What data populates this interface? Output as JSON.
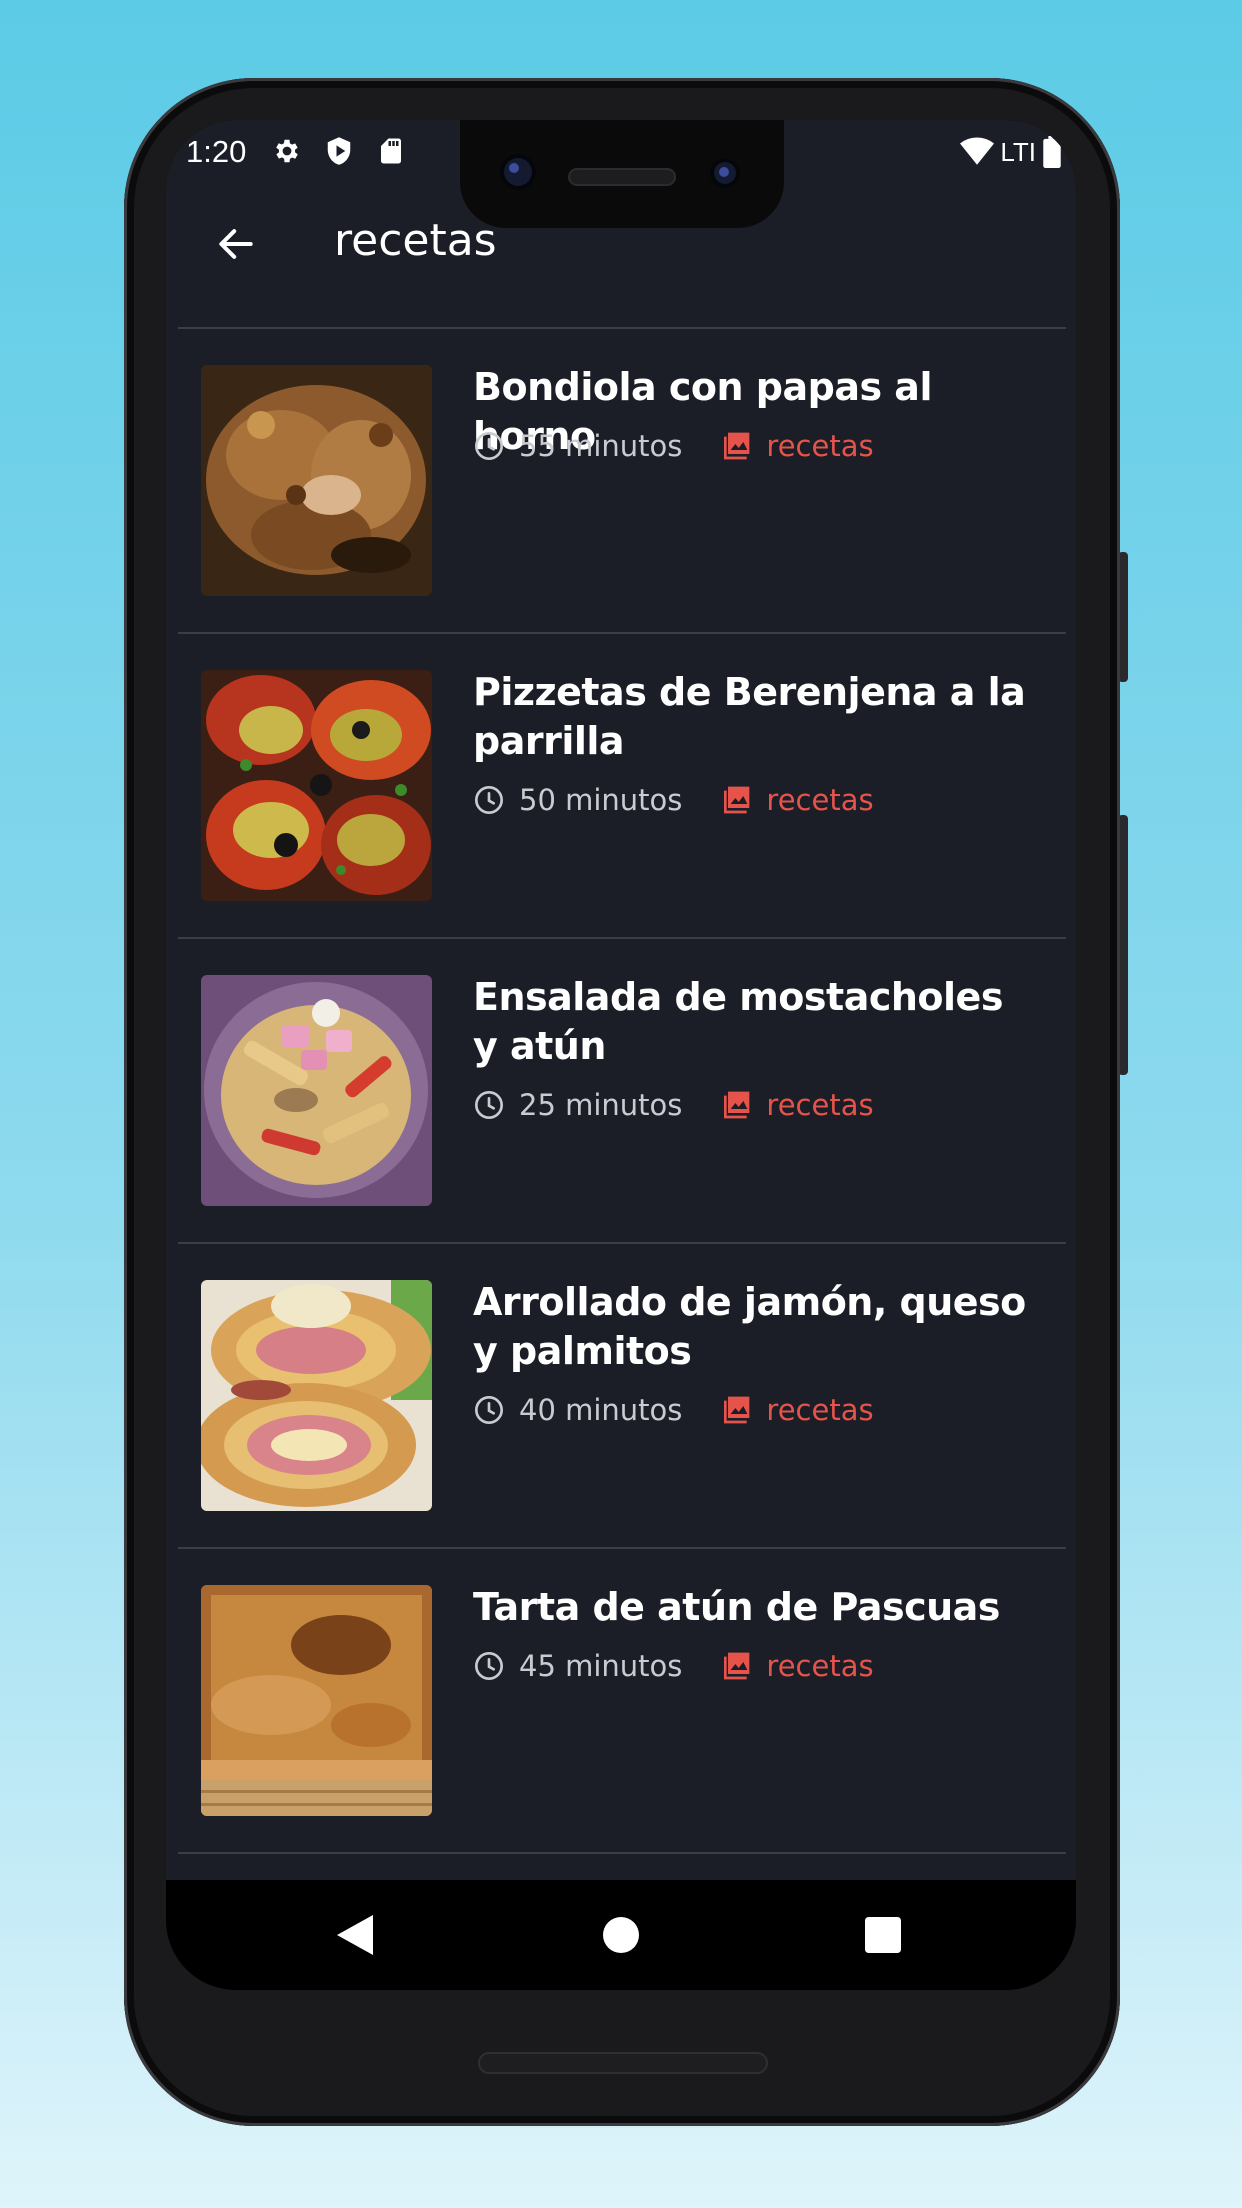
{
  "status_bar": {
    "time": "1:20",
    "network": "LTI",
    "icons": [
      "settings-icon",
      "shield-play-icon",
      "sd-card-icon",
      "wifi-icon",
      "battery-icon"
    ]
  },
  "app_bar": {
    "title": "recetas",
    "back_icon": "arrow-back-icon"
  },
  "colors": {
    "background": "#1b1e26",
    "accent": "#e5534b",
    "text": "#ffffff",
    "muted": "#c9cbd0",
    "divider": "#3a3e47"
  },
  "recipes": [
    {
      "title": "Bondiola con papas al horno",
      "duration": "55 minutos",
      "category": "recetas"
    },
    {
      "title": "Pizzetas de Berenjena a la parrilla",
      "duration": "50 minutos",
      "category": "recetas"
    },
    {
      "title": "Ensalada de mostacholes y atún",
      "duration": "25 minutos",
      "category": "recetas"
    },
    {
      "title": "Arrollado de jamón, queso y palmitos",
      "duration": "40 minutos",
      "category": "recetas"
    },
    {
      "title": "Tarta de atún de Pascuas",
      "duration": "45 minutos",
      "category": "recetas"
    }
  ],
  "nav_bar": {
    "icons": [
      "back-triangle-icon",
      "home-circle-icon",
      "recents-square-icon"
    ]
  }
}
